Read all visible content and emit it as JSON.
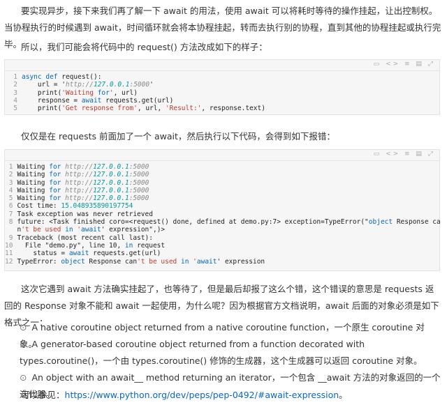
{
  "intro": "要实现异步，接下来我们再了解一下 await 的用法，使用 await 可以将耗时等待的操作挂起，让出控制权。当协程执行的时候遇到 await，时间循环就会将本协程挂起，转而去执行别的协程，直到其他的协程挂起或执行完毕。",
  "p2": "所以，我们可能会将代码中的 request() 方法改成如下的样子：",
  "code1": {
    "nums": [
      "1",
      "2",
      "3",
      "4",
      "5"
    ],
    "lines": [
      "async def request():",
      "    url = 'http://127.0.0.1:5000'",
      "    print('Waiting for', url)",
      "    response = await requests.get(url)",
      "    print('Get response from', url, 'Result:', response.text)"
    ]
  },
  "p3": "仅仅是在 requests 前面加了一个 await，然后执行以下代码，会得到如下报错：",
  "code2": {
    "nums": [
      "1",
      "2",
      "3",
      "4",
      "5",
      "6",
      "7",
      "8",
      "",
      "9",
      "10",
      "11",
      "12",
      ""
    ],
    "lines": [
      "Waiting for http://127.0.0.1:5000",
      "Waiting for http://127.0.0.1:5000",
      "Waiting for http://127.0.0.1:5000",
      "Waiting for http://127.0.0.1:5000",
      "Waiting for http://127.0.0.1:5000",
      "Cost time: 15.048935890197754",
      "Task exception was never retrieved",
      "future: <Task finished coro=<request() done, defined at demo.py:7> exception=TypeError(\"object Response ca",
      "n't be used in 'await' expression\",)>",
      "Traceback (most recent call last):",
      "  File \"demo.py\", line 10, in request",
      "    status = await requests.get(url)",
      "TypeError: object Response can't be used in 'await' expression",
      ""
    ]
  },
  "p4": "这次它遇到 await 方法确实挂起了，也等待了，但是最后却报了这么个错，这个错误的意思是 requests 返回的 Response 对象不能和 await 一起使用，为什么呢？因为根据官方文档说明，await 后面的对象必须是如下格式之一：",
  "bullets": [
    "A native coroutine object returned from a native coroutine function，一个原生 coroutine 对象。",
    "A generator-based coroutine object returned from a function decorated with types.coroutine()，一个由 types.coroutine() 修饰的生成器，这个生成器可以返回 coroutine 对象。",
    "An object with an await__ method returning an iterator，一个包含 __await 方法的对象返回的一个迭代器。"
  ],
  "bullet_mark": "⊙",
  "ref": {
    "label": "可以参见：",
    "url": "https://www.python.org/dev/peps/pep-0492/#await-expression",
    "end": "。"
  },
  "toolbar_glyphs": "▭ <> ≡ ▤ ⤢",
  "colors": {
    "keyword": "#0066bb",
    "string": "#c0392b",
    "link": "#0a66c2"
  }
}
